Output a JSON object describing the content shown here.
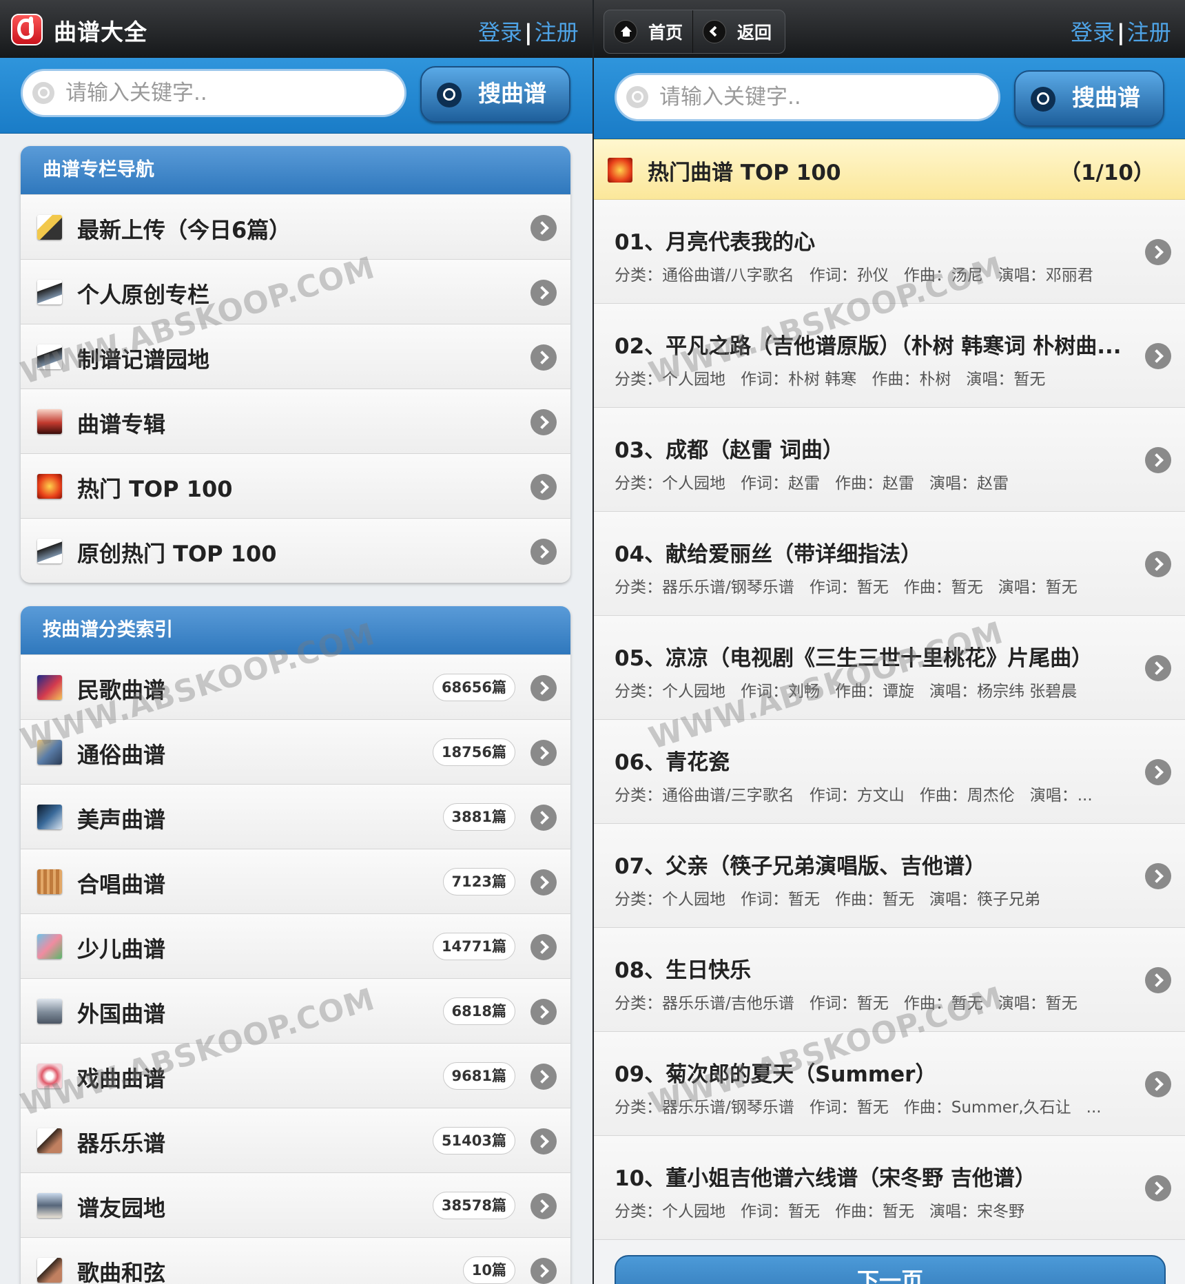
{
  "left": {
    "header": {
      "title": "曲谱大全",
      "login": "登录",
      "register": "注册"
    },
    "search": {
      "placeholder": "请输入关键字..",
      "button": "搜曲谱"
    },
    "nav_section": {
      "title": "曲谱专栏导航",
      "items": [
        {
          "label": "最新上传（今日6篇）"
        },
        {
          "label": "个人原创专栏"
        },
        {
          "label": "制谱记谱园地"
        },
        {
          "label": "曲谱专辑"
        },
        {
          "label": "热门 TOP 100"
        },
        {
          "label": "原创热门 TOP 100"
        }
      ]
    },
    "category_section": {
      "title": "按曲谱分类索引",
      "items": [
        {
          "label": "民歌曲谱",
          "count": "68656篇"
        },
        {
          "label": "通俗曲谱",
          "count": "18756篇"
        },
        {
          "label": "美声曲谱",
          "count": "3881篇"
        },
        {
          "label": "合唱曲谱",
          "count": "7123篇"
        },
        {
          "label": "少儿曲谱",
          "count": "14771篇"
        },
        {
          "label": "外国曲谱",
          "count": "6818篇"
        },
        {
          "label": "戏曲曲谱",
          "count": "9681篇"
        },
        {
          "label": "器乐乐谱",
          "count": "51403篇"
        },
        {
          "label": "谱友园地",
          "count": "38578篇"
        },
        {
          "label": "歌曲和弦",
          "count": "10篇"
        }
      ]
    }
  },
  "right": {
    "header": {
      "home": "首页",
      "back": "返回",
      "login": "登录",
      "register": "注册"
    },
    "search": {
      "placeholder": "请输入关键字..",
      "button": "搜曲谱"
    },
    "list": {
      "title": "热门曲谱 TOP 100",
      "page": "（1/10）",
      "songs": [
        {
          "title": "01、月亮代表我的心",
          "meta": [
            "分类：通俗曲谱/八字歌名",
            "作词：孙仪",
            "作曲：汤尼",
            "演唱：邓丽君"
          ]
        },
        {
          "title": "02、平凡之路（吉他谱原版）（朴树 韩寒词 朴树曲...",
          "meta": [
            "分类：个人园地",
            "作词：朴树 韩寒",
            "作曲：朴树",
            "演唱：暂无"
          ]
        },
        {
          "title": "03、成都（赵雷 词曲）",
          "meta": [
            "分类：个人园地",
            "作词：赵雷",
            "作曲：赵雷",
            "演唱：赵雷"
          ]
        },
        {
          "title": "04、献给爱丽丝（带详细指法）",
          "meta": [
            "分类：器乐乐谱/钢琴乐谱",
            "作词：暂无",
            "作曲：暂无",
            "演唱：暂无"
          ]
        },
        {
          "title": "05、凉凉（电视剧《三生三世十里桃花》片尾曲）",
          "meta": [
            "分类：个人园地",
            "作词：刘畅",
            "作曲：谭旋",
            "演唱：杨宗纬 张碧晨"
          ]
        },
        {
          "title": "06、青花瓷",
          "meta": [
            "分类：通俗曲谱/三字歌名",
            "作词：方文山",
            "作曲：周杰伦",
            "演唱：..."
          ]
        },
        {
          "title": "07、父亲（筷子兄弟演唱版、吉他谱）",
          "meta": [
            "分类：个人园地",
            "作词：暂无",
            "作曲：暂无",
            "演唱：筷子兄弟"
          ]
        },
        {
          "title": "08、生日快乐",
          "meta": [
            "分类：器乐乐谱/吉他乐谱",
            "作词：暂无",
            "作曲：暂无",
            "演唱：暂无"
          ]
        },
        {
          "title": "09、菊次郎的夏天（Summer）",
          "meta": [
            "分类：器乐乐谱/钢琴乐谱",
            "作词：暂无",
            "作曲：Summer,久石让",
            "..."
          ]
        },
        {
          "title": "10、董小姐吉他谱六线谱（宋冬野 吉他谱）",
          "meta": [
            "分类：个人园地",
            "作词：暂无",
            "作曲：暂无",
            "演唱：宋冬野"
          ]
        }
      ],
      "next": "下一页"
    }
  },
  "watermark": "WWW.ABSKOOP.COM",
  "colors": {
    "topbar": "#1f2124",
    "search_bg": "#2486d0",
    "accent_link": "#4ea3e6",
    "section_header": "#3e86c8",
    "top_header": "#fbe9a4"
  }
}
